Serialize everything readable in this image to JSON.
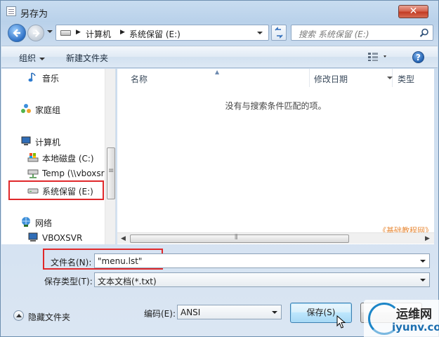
{
  "window": {
    "title": "另存为",
    "close_label": "✕"
  },
  "address": {
    "crumbs": [
      "计算机",
      "系统保留 (E:)"
    ],
    "search_placeholder": "搜索 系统保留 (E:)"
  },
  "toolbar": {
    "organize_label": "组织",
    "new_folder_label": "新建文件夹",
    "help_label": "?"
  },
  "nav": {
    "items": [
      {
        "label": "音乐",
        "icon": "music-icon"
      },
      {
        "label": "家庭组",
        "icon": "homegroup-icon"
      },
      {
        "label": "计算机",
        "icon": "computer-icon"
      },
      {
        "label": "本地磁盘 (C:)",
        "icon": "local-disk-icon"
      },
      {
        "label": "Temp (\\\\vboxsr",
        "icon": "network-drive-icon"
      },
      {
        "label": "系统保留 (E:)",
        "icon": "drive-icon"
      },
      {
        "label": "网络",
        "icon": "network-icon"
      },
      {
        "label": "VBOXSVR",
        "icon": "server-icon"
      }
    ]
  },
  "filelist": {
    "columns": [
      "名称",
      "修改日期",
      "类型"
    ],
    "empty_message": "没有与搜索条件匹配的项。",
    "watermark": "《基础教程网》"
  },
  "form": {
    "filename_label": "文件名(N):",
    "filename_value": "\"menu.lst\"",
    "filetype_label": "保存类型(T):",
    "filetype_value": "文本文档(*.txt)",
    "encoding_label": "编码(E):",
    "encoding_value": "ANSI",
    "hide_folders_label": "隐藏文件夹",
    "save_label": "保存(S)"
  },
  "logo": {
    "text_cn": "运维网",
    "text_url": "iyunv.com"
  },
  "colors": {
    "highlight_box": "#e0282a",
    "accent": "#1c86c8"
  }
}
